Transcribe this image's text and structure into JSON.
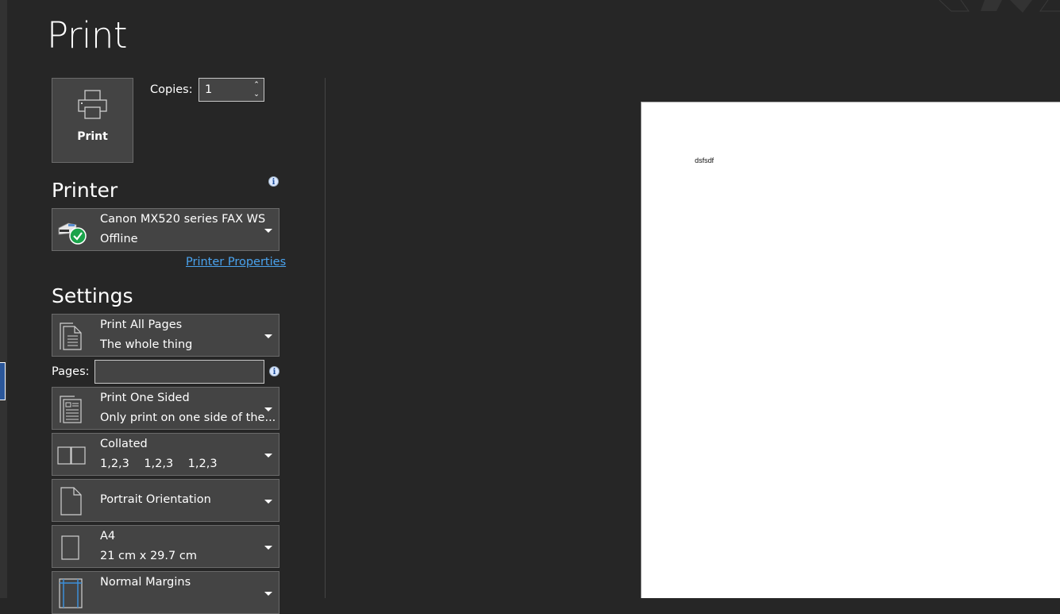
{
  "title": "Print",
  "print_button": {
    "label": "Print",
    "icon": "printer-icon"
  },
  "copies": {
    "label": "Copies:",
    "value": "1"
  },
  "printer": {
    "heading": "Printer",
    "name": "Canon MX520 series FAX WS",
    "status": "Offline",
    "icon": "fax-printer-ready-icon",
    "properties_link": "Printer Properties"
  },
  "settings": {
    "heading": "Settings",
    "pages_label": "Pages:",
    "pages_value": "",
    "options": [
      {
        "title": "Print All Pages",
        "subtitle": "The whole thing",
        "icon": "pages-icon"
      },
      {
        "title": "Print One Sided",
        "subtitle": "Only print on one side of the...",
        "icon": "one-sided-icon"
      },
      {
        "title": "Collated",
        "subtitle": "1,2,3    1,2,3    1,2,3",
        "icon": "collated-icon"
      },
      {
        "title": "Portrait Orientation",
        "subtitle": "",
        "icon": "portrait-icon"
      },
      {
        "title": "A4",
        "subtitle": "21 cm x 29.7 cm",
        "icon": "paper-size-icon"
      },
      {
        "title": "Normal Margins",
        "subtitle": "",
        "icon": "margins-icon"
      }
    ]
  },
  "preview": {
    "text": "dsfsdf"
  }
}
